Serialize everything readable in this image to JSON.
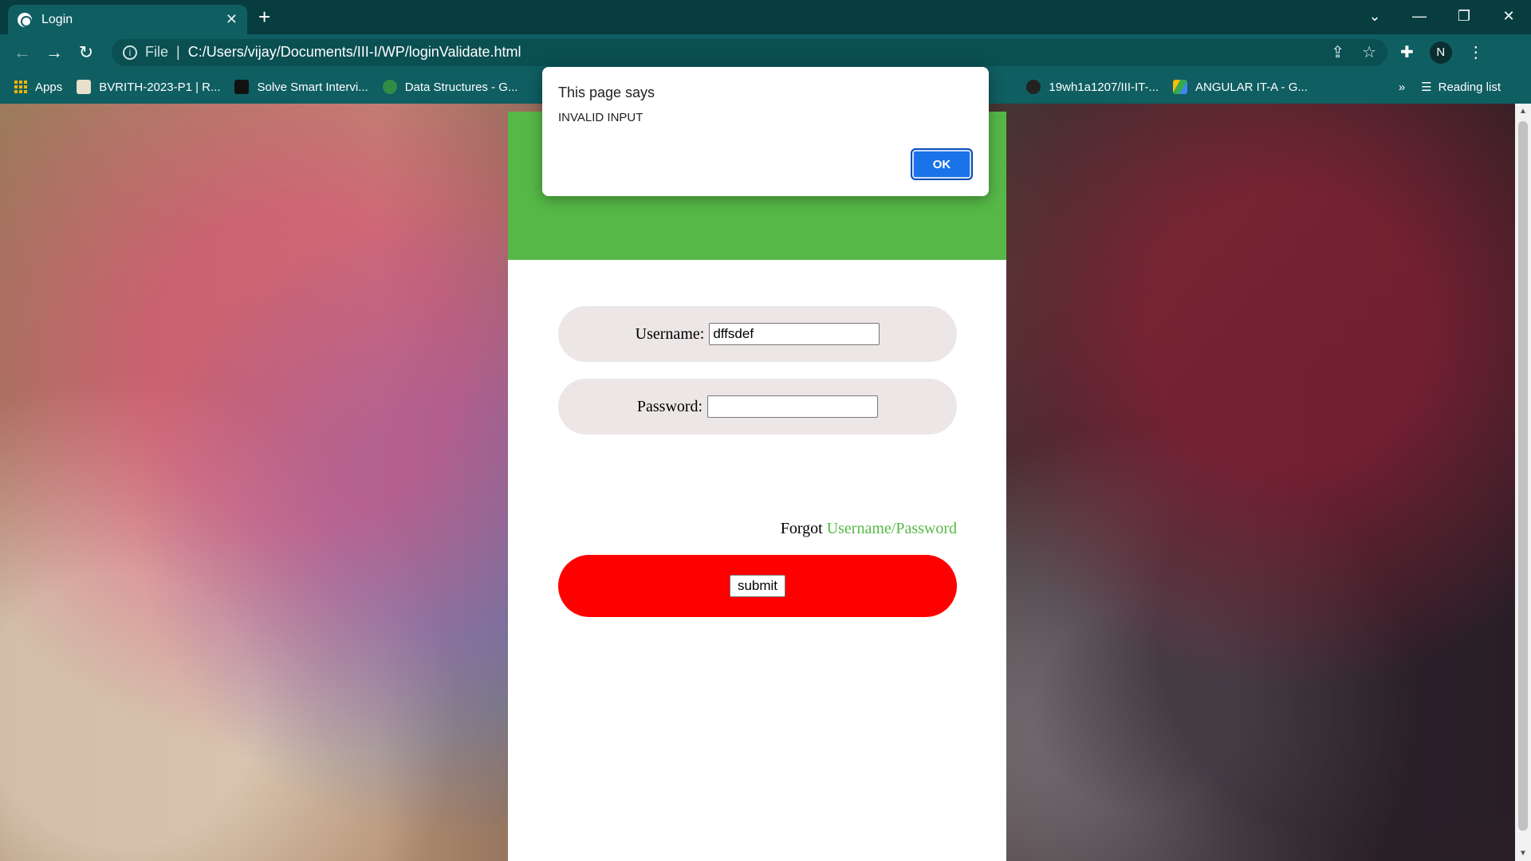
{
  "browser": {
    "tab_title": "Login",
    "tab_close": "✕",
    "new_tab": "+",
    "window_controls": [
      "⌄",
      "—",
      "❐",
      "✕"
    ],
    "address": {
      "scheme_label": "File",
      "url": "C:/Users/vijay/Documents/III-I/WP/loginValidate.html"
    },
    "profile_initial": "N",
    "bookmarks": [
      {
        "label": "Apps",
        "icon": "apps-grid-icon"
      },
      {
        "label": "BVRITH-2023-P1 | R...",
        "icon": "bvrith-icon"
      },
      {
        "label": "Solve Smart Intervi...",
        "icon": "interview-icon"
      },
      {
        "label": "Data Structures - G...",
        "icon": "gfg-icon"
      },
      {
        "label": "19wh1a1207/III-IT-...",
        "icon": "github-icon"
      },
      {
        "label": "ANGULAR IT-A - G...",
        "icon": "drive-icon"
      }
    ],
    "bookmarks_overflow": "»",
    "reading_list": "Reading list"
  },
  "page": {
    "username_label": "Username:",
    "username_value": "dffsdef",
    "password_label": "Password:",
    "password_value": "",
    "forgot_prefix": "Forgot",
    "forgot_link": "Username/Password",
    "submit_label": "submit"
  },
  "alert": {
    "heading": "This page says",
    "message": "INVALID INPUT",
    "ok_label": "OK"
  },
  "colors": {
    "header_green": "#56b947",
    "submit_red": "#ff0000",
    "pill_gray": "#ece7e6",
    "chrome_teal": "#0f5e62",
    "ok_blue": "#1a73e8"
  }
}
